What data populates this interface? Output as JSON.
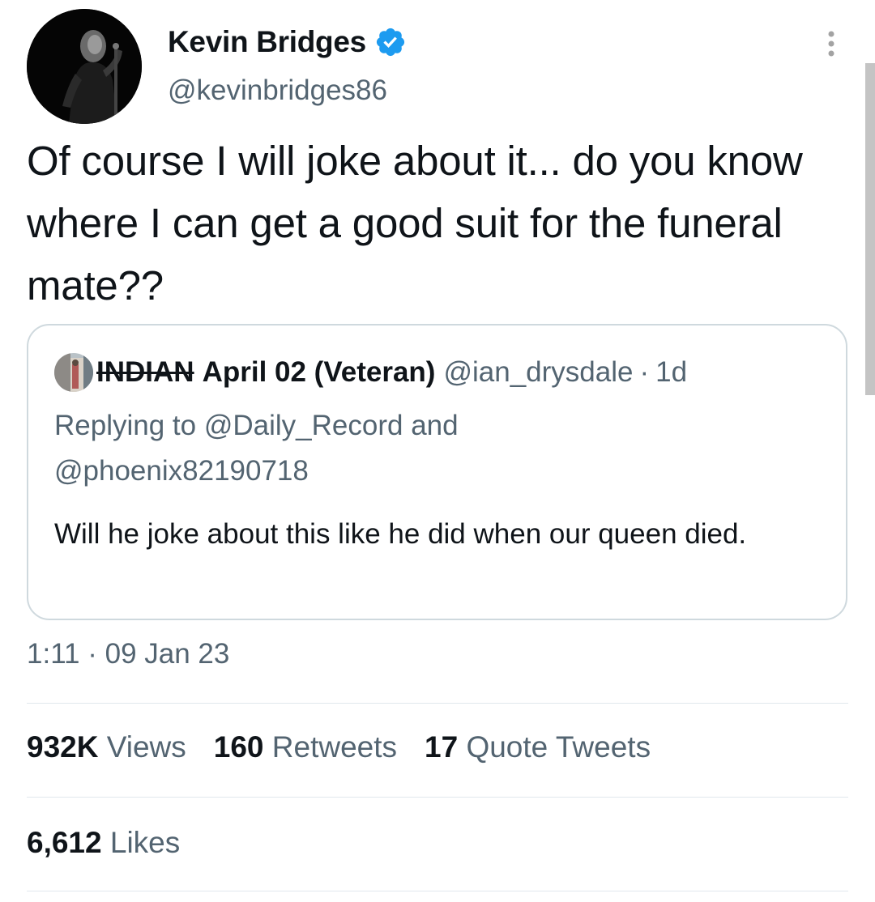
{
  "author": {
    "display_name": "Kevin Bridges",
    "handle": "@kevinbridges86",
    "verified": true,
    "verified_color": "#1d9bf0"
  },
  "tweet": {
    "text": "Of course I will joke about it... do you know where I can get a good suit for the funeral mate??",
    "timestamp": "1:11 · 09 Jan 23"
  },
  "quoted_tweet": {
    "name_struck": "INDIAN",
    "name_rest": "April 02 (Veteran)",
    "handle": "@ian_drysdale",
    "separator": "·",
    "age": "1d",
    "replying_prefix": "Replying to",
    "reply_mention_1": "@Daily_Record",
    "reply_and": "and",
    "reply_mention_2": "@phoenix82190718",
    "text": "Will he joke about this like he did when our queen died."
  },
  "stats": {
    "views_count": "932K",
    "views_label": "Views",
    "retweets_count": "160",
    "retweets_label": "Retweets",
    "quotes_count": "17",
    "quotes_label": "Quote Tweets",
    "likes_count": "6,612",
    "likes_label": "Likes"
  },
  "icons": {
    "verified": "verified-badge-icon",
    "more": "more-vertical-icon"
  }
}
